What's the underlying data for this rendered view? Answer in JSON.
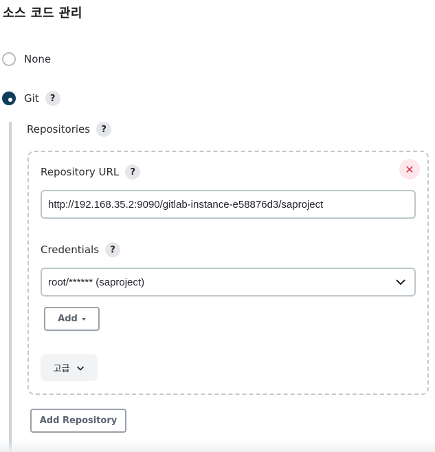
{
  "section_title": "소스 코드 관리",
  "scm_options": [
    {
      "label": "None",
      "selected": false
    },
    {
      "label": "Git",
      "selected": true
    }
  ],
  "help_glyph": "?",
  "repositories": {
    "label": "Repositories",
    "repository_url_label": "Repository URL",
    "repository_url_value": "http://192.168.35.2:9090/gitlab-instance-e58876d3/saproject",
    "credentials_label": "Credentials",
    "credentials_value": "root/****** (saproject)",
    "add_label": "Add",
    "advanced_label": "고급",
    "delete_glyph": "✕",
    "add_repository_label": "Add Repository"
  },
  "colors": {
    "radio_selected": "#0f3d5c",
    "delete_icon": "#e02d46",
    "delete_bg": "#fde7ea"
  }
}
